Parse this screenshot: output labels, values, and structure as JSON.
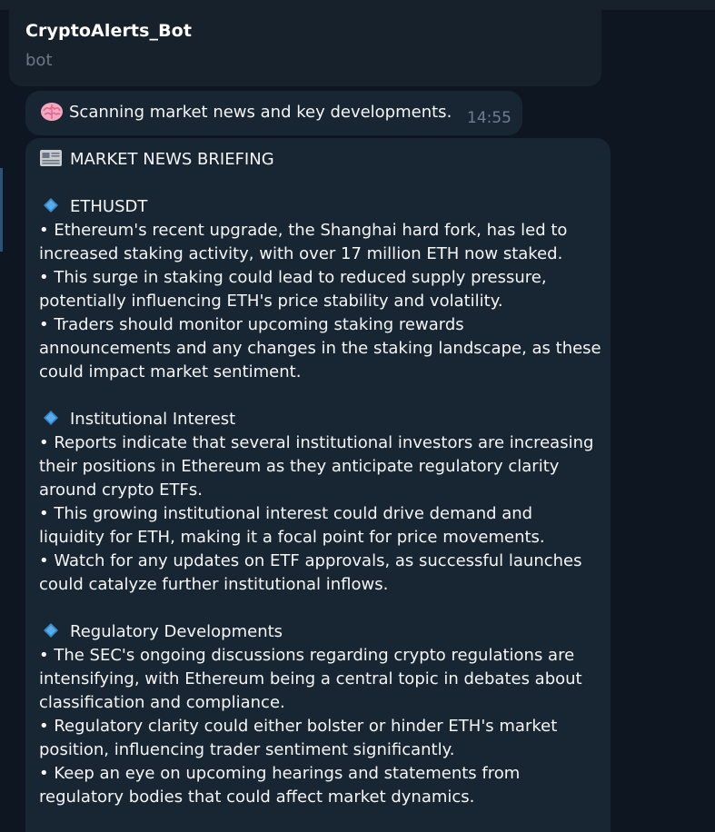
{
  "header": {
    "title": "CryptoAlerts_Bot",
    "subtitle": "bot"
  },
  "status_message": {
    "icon": "brain-emoji",
    "text": "Scanning market news and key developments.",
    "time": "14:55"
  },
  "briefing": {
    "header_icon": "newspaper-emoji",
    "title": "MARKET NEWS BRIEFING",
    "sections": [
      {
        "icon": "blue-diamond-emoji",
        "heading": "ETHUSDT",
        "lines": [
          "• Ethereum's recent upgrade, the Shanghai hard fork, has led to",
          "increased staking activity, with over 17 million ETH now staked.",
          "• This surge in staking could lead to reduced supply pressure,",
          "potentially influencing ETH's price stability and volatility.",
          "• Traders should monitor upcoming staking rewards",
          "announcements and any changes in the staking landscape, as these",
          "could impact market sentiment."
        ]
      },
      {
        "icon": "blue-diamond-emoji",
        "heading": "Institutional Interest",
        "lines": [
          "• Reports indicate that several institutional investors are increasing",
          "their positions in Ethereum as they anticipate regulatory clarity",
          "around crypto ETFs.",
          "• This growing institutional interest could drive demand and",
          "liquidity for ETH, making it a focal point for price movements.",
          "• Watch for any updates on ETF approvals, as successful launches",
          "could catalyze further institutional inflows."
        ]
      },
      {
        "icon": "blue-diamond-emoji",
        "heading": "Regulatory Developments",
        "lines": [
          "• The SEC's ongoing discussions regarding crypto regulations are",
          "intensifying, with Ethereum being a central topic in debates about",
          "classification and compliance.",
          "• Regulatory clarity could either bolster or hinder ETH's market",
          "position, influencing trader sentiment significantly.",
          "• Keep an eye on upcoming hearings and statements from",
          "regulatory bodies that could affect market dynamics."
        ]
      }
    ]
  },
  "colors": {
    "background": "#0e1621",
    "bubble": "#182533",
    "header": "#17212b",
    "accent": "#2b5278",
    "time": "#6d7f8f",
    "diamond": "#3b88c3"
  }
}
